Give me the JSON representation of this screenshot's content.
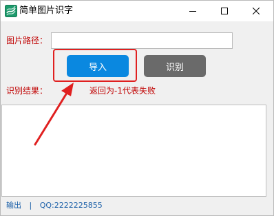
{
  "window": {
    "title": "简单图片识字",
    "icon": "app-logo-icon"
  },
  "form": {
    "path_label": "图片路径：",
    "path_value": "",
    "path_placeholder": "",
    "import_button": "导入",
    "recognize_button": "识别",
    "result_label": "识别结果：",
    "status_text": "返回为-1代表失败",
    "result_text": ""
  },
  "footer": {
    "output_link": "输出",
    "separator": "|",
    "qq": "QQ:2222225855"
  },
  "colors": {
    "import_button": "#0a88e0",
    "recognize_button": "#6a6a6a",
    "label_red": "#c00000",
    "highlight": "#e02020",
    "footer_link": "#1a5fa8"
  }
}
